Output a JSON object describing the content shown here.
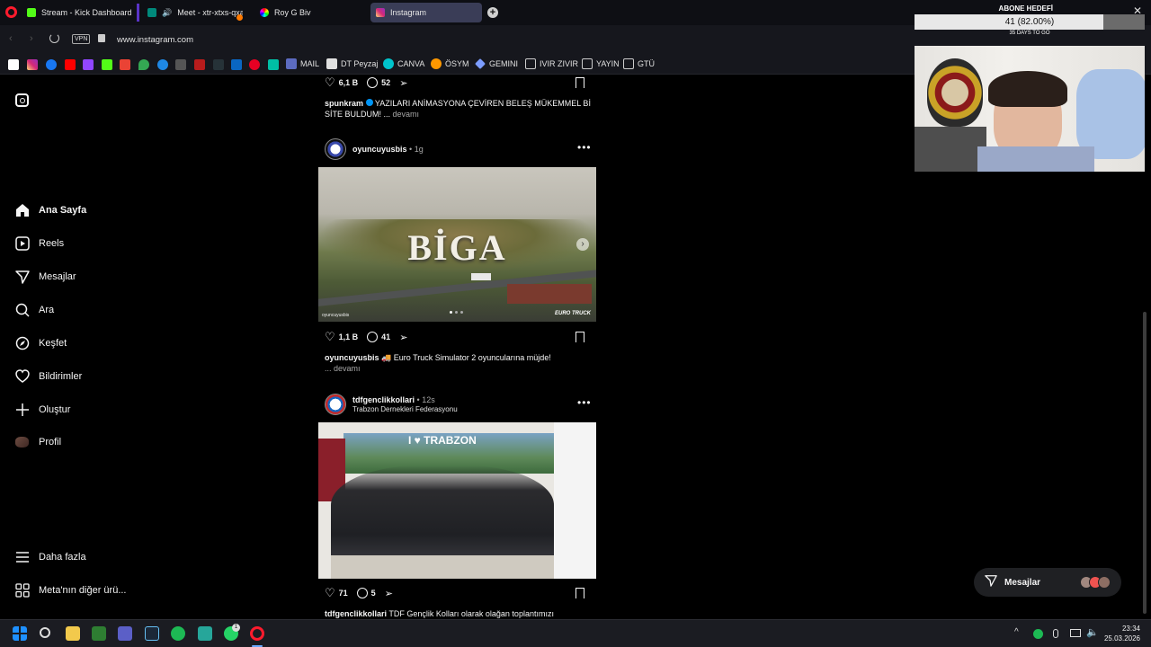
{
  "browser": {
    "tabs": [
      {
        "label": "Stream - Kick Dashboard",
        "color": "#53fc18"
      },
      {
        "label": "Meet - xtr-xtxs-qxa",
        "color": "#00897b"
      },
      {
        "label": "Roy G Biv",
        "color": "#e040fb"
      },
      {
        "label": "Instagram",
        "color": "#e1306c"
      }
    ],
    "url": "www.instagram.com",
    "vpn_label": "VPN",
    "bookmarks": [
      {
        "label": "MAIL"
      },
      {
        "label": "DT Peyzaj"
      },
      {
        "label": "CANVA"
      },
      {
        "label": "ÖSYM"
      },
      {
        "label": "GEMINI"
      },
      {
        "label": "IVIR ZIVIR"
      },
      {
        "label": "YAYIN"
      },
      {
        "label": "GTÜ"
      }
    ]
  },
  "overlay": {
    "title": "ABONE HEDEFİ",
    "progress_text": "41 (82.00%)",
    "progress_fraction": 0.82,
    "days_text": "35 DAYS TO GO"
  },
  "sidebar": {
    "items": [
      {
        "label": "Ana Sayfa",
        "icon": "home-icon",
        "active": true
      },
      {
        "label": "Reels",
        "icon": "reels-icon"
      },
      {
        "label": "Mesajlar",
        "icon": "messages-icon"
      },
      {
        "label": "Ara",
        "icon": "search-icon"
      },
      {
        "label": "Keşfet",
        "icon": "explore-icon"
      },
      {
        "label": "Bildirimler",
        "icon": "heart-icon"
      },
      {
        "label": "Oluştur",
        "icon": "plus-icon"
      },
      {
        "label": "Profil",
        "icon": "profile-avatar"
      }
    ],
    "more": "Daha fazla",
    "meta": "Meta'nın diğer ürü..."
  },
  "posts": [
    {
      "likes": "6,1 B",
      "comments": "52",
      "caption_user": "spunkram",
      "caption_text": "YAZILARI ANİMASYONA ÇEVİREN BELEŞ MÜKEMMEL Bİ SİTE BULDUM! ...",
      "more": "devamı"
    },
    {
      "user": "oyuncuyusbis",
      "time": "1g",
      "image_text": "BİGA",
      "watermark_left": "oyuncuyusbis",
      "watermark_right": "EURO TRUCK",
      "likes": "1,1 B",
      "comments": "41",
      "caption_user": "oyuncuyusbis",
      "caption_text": "🚚 Euro Truck Simulator 2 oyuncularına müjde!",
      "more": "... devamı"
    },
    {
      "user": "tdfgenclikkollari",
      "time": "12s",
      "subtitle": "Trabzon Dernekleri Federasyonu",
      "image_text": "I ♥ TRABZON",
      "likes": "71",
      "comments": "5",
      "caption_user": "tdfgenclikkollari",
      "caption_text": "TDF Gençlik Kolları olarak olağan toplantımızı"
    }
  ],
  "messages_pill": "Mesajlar",
  "taskbar": {
    "time": "23:34",
    "date": "25.03.2026",
    "badge": "1"
  }
}
